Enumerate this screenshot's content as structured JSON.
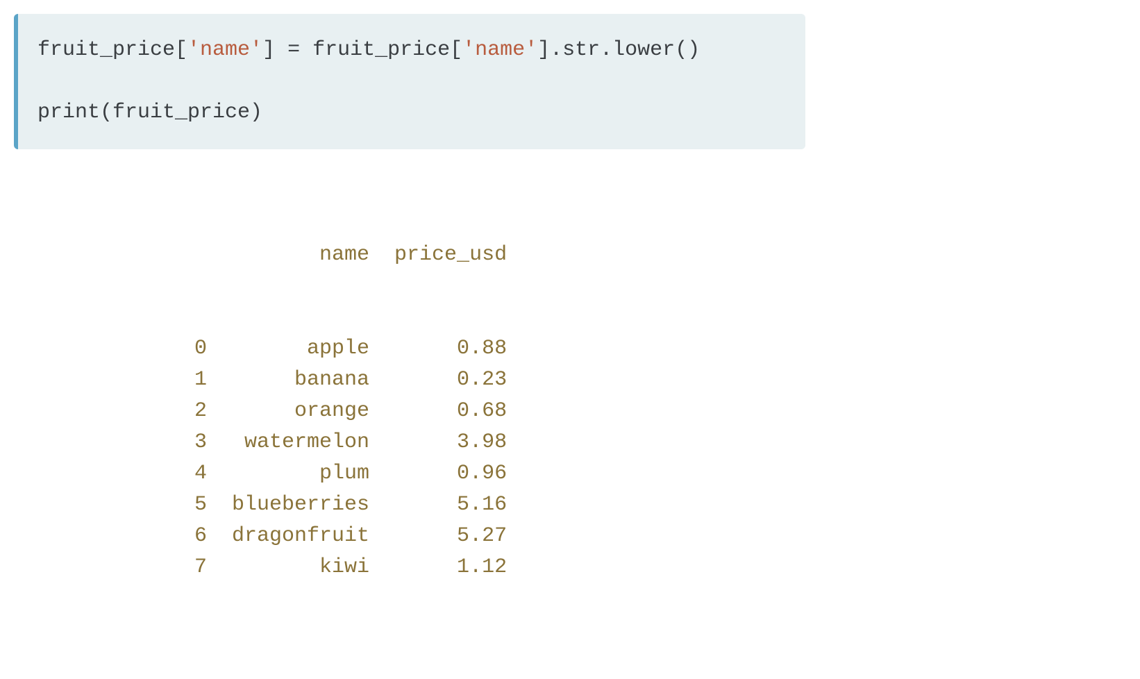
{
  "code": {
    "line1_parts": [
      {
        "text": "fruit_price[",
        "type": "plain"
      },
      {
        "text": "'name'",
        "type": "string"
      },
      {
        "text": "] = fruit_price[",
        "type": "plain"
      },
      {
        "text": "'name'",
        "type": "string"
      },
      {
        "text": "].str.lower()",
        "type": "plain"
      }
    ],
    "line2": "",
    "line3": "print(fruit_price)"
  },
  "output": {
    "header": {
      "col1": "name",
      "col2": "price_usd"
    },
    "rows": [
      {
        "idx": "0",
        "name": "apple",
        "price": "0.88"
      },
      {
        "idx": "1",
        "name": "banana",
        "price": "0.23"
      },
      {
        "idx": "2",
        "name": "orange",
        "price": "0.68"
      },
      {
        "idx": "3",
        "name": "watermelon",
        "price": "3.98"
      },
      {
        "idx": "4",
        "name": "plum",
        "price": "0.96"
      },
      {
        "idx": "5",
        "name": "blueberries",
        "price": "5.16"
      },
      {
        "idx": "6",
        "name": "dragonfruit",
        "price": "5.27"
      },
      {
        "idx": "7",
        "name": "kiwi",
        "price": "1.12"
      }
    ]
  }
}
